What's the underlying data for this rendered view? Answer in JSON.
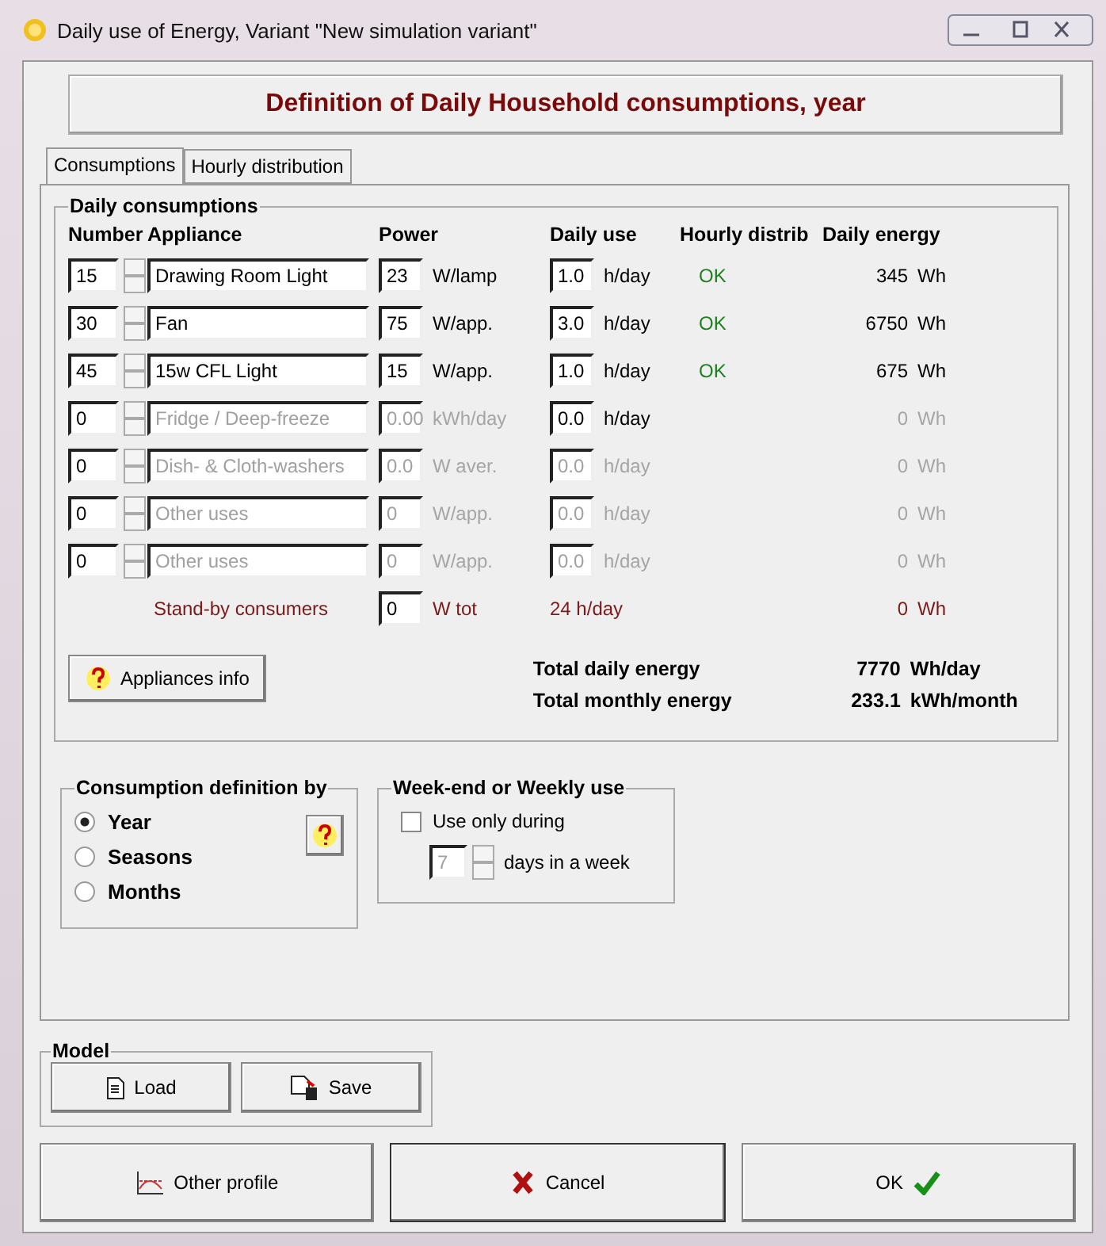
{
  "window": {
    "title": "Daily use of Energy, Variant  \"New simulation variant\""
  },
  "header": "Definition of Daily Household consumptions, year",
  "tabs": [
    {
      "label": "Consumptions",
      "selected": true
    },
    {
      "label": "Hourly distribution",
      "selected": false
    }
  ],
  "daily_consumptions": {
    "title": "Daily consumptions",
    "columns": [
      "Number",
      "Appliance",
      "Power",
      "Daily use",
      "Hourly distrib",
      "Daily energy"
    ],
    "rows": [
      {
        "number": "15",
        "appliance": "Drawing Room Light",
        "power": "23",
        "power_unit": "W/lamp",
        "daily_use": "1.0",
        "use_unit": "h/day",
        "hourly": "OK",
        "energy": "345",
        "energy_unit": "Wh",
        "disabled": false,
        "use_disabled": false
      },
      {
        "number": "30",
        "appliance": "Fan",
        "power": "75",
        "power_unit": "W/app.",
        "daily_use": "3.0",
        "use_unit": "h/day",
        "hourly": "OK",
        "energy": "6750",
        "energy_unit": "Wh",
        "disabled": false,
        "use_disabled": false
      },
      {
        "number": "45",
        "appliance": "15w CFL  Light",
        "power": "15",
        "power_unit": "W/app.",
        "daily_use": "1.0",
        "use_unit": "h/day",
        "hourly": "OK",
        "energy": "675",
        "energy_unit": "Wh",
        "disabled": false,
        "use_disabled": false
      },
      {
        "number": "0",
        "appliance": "Fridge / Deep-freeze",
        "power": "0.00",
        "power_unit": "kWh/day",
        "daily_use": "0.0",
        "use_unit": "h/day",
        "energy": "0",
        "energy_unit": "Wh",
        "disabled": true,
        "use_disabled": false
      },
      {
        "number": "0",
        "appliance": "Dish- & Cloth-washers",
        "power": "0.0",
        "power_unit": "W aver.",
        "daily_use": "0.0",
        "use_unit": "h/day",
        "energy": "0",
        "energy_unit": "Wh",
        "disabled": true,
        "use_disabled": true
      },
      {
        "number": "0",
        "appliance": "Other uses",
        "power": "0",
        "power_unit": "W/app.",
        "daily_use": "0.0",
        "use_unit": "h/day",
        "energy": "0",
        "energy_unit": "Wh",
        "disabled": true,
        "use_disabled": true
      },
      {
        "number": "0",
        "appliance": "Other uses",
        "power": "0",
        "power_unit": "W/app.",
        "daily_use": "0.0",
        "use_unit": "h/day",
        "energy": "0",
        "energy_unit": "Wh",
        "disabled": true,
        "use_disabled": true
      }
    ],
    "standby": {
      "label": "Stand-by consumers",
      "power": "0",
      "power_unit": "W tot",
      "use": "24 h/day",
      "energy": "0",
      "energy_unit": "Wh"
    },
    "info_button": "Appliances info",
    "totals": [
      {
        "label": "Total daily energy",
        "value": "7770",
        "unit": "Wh/day"
      },
      {
        "label": "Total monthly energy",
        "value": "233.1",
        "unit": "kWh/month"
      }
    ]
  },
  "consumption_definition": {
    "title": "Consumption definition by",
    "options": [
      {
        "label": "Year",
        "selected": true
      },
      {
        "label": "Seasons",
        "selected": false
      },
      {
        "label": "Months",
        "selected": false
      }
    ]
  },
  "weekly_use": {
    "title": "Week-end or Weekly use",
    "checkbox": {
      "label": "Use only during",
      "checked": false
    },
    "days": "7",
    "days_label": "days in a week"
  },
  "model": {
    "title": "Model",
    "buttons": [
      "Load",
      "Save"
    ]
  },
  "buttons": [
    {
      "kind": "profile",
      "label": "Other profile"
    },
    {
      "kind": "cancel",
      "label": "Cancel"
    },
    {
      "kind": "ok",
      "label": "OK"
    }
  ]
}
